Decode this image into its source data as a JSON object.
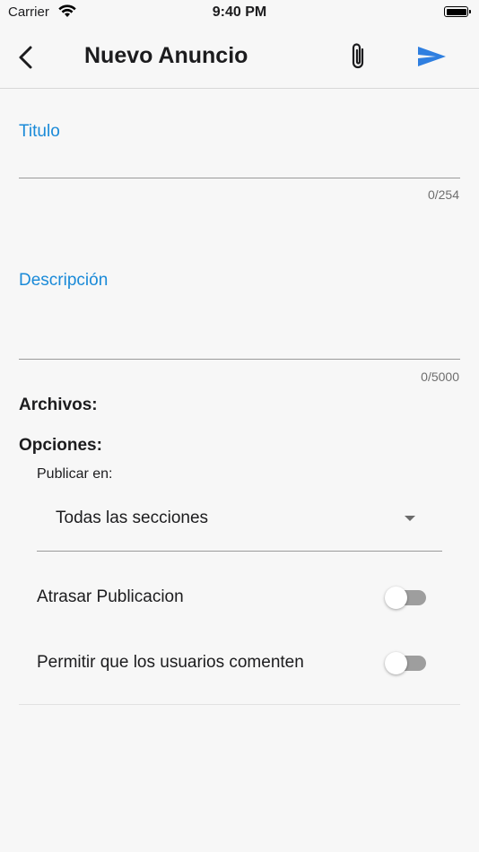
{
  "status_bar": {
    "carrier": "Carrier",
    "time": "9:40 PM",
    "wifi_icon": "wifi-icon",
    "battery_icon": "battery-icon"
  },
  "navbar": {
    "title": "Nuevo Anuncio",
    "back_icon": "chevron-left-icon",
    "attach_icon": "paperclip-icon",
    "send_icon": "send-icon",
    "accent_color": "#2f7fe0"
  },
  "form": {
    "title_field": {
      "label": "Titulo",
      "value": "",
      "counter": "0/254"
    },
    "description_field": {
      "label": "Descripción",
      "value": "",
      "counter": "0/5000"
    },
    "files_label": "Archivos:",
    "options_label": "Opciones:",
    "publish_in": {
      "label": "Publicar en:",
      "selected": "Todas las secciones"
    },
    "toggles": [
      {
        "label": "Atrasar Publicacion",
        "on": false
      },
      {
        "label": "Permitir que los usuarios comenten",
        "on": false
      }
    ]
  },
  "colors": {
    "label_blue": "#1a8ad8",
    "background": "#f7f7f7",
    "switch_off": "#9e9e9e"
  }
}
